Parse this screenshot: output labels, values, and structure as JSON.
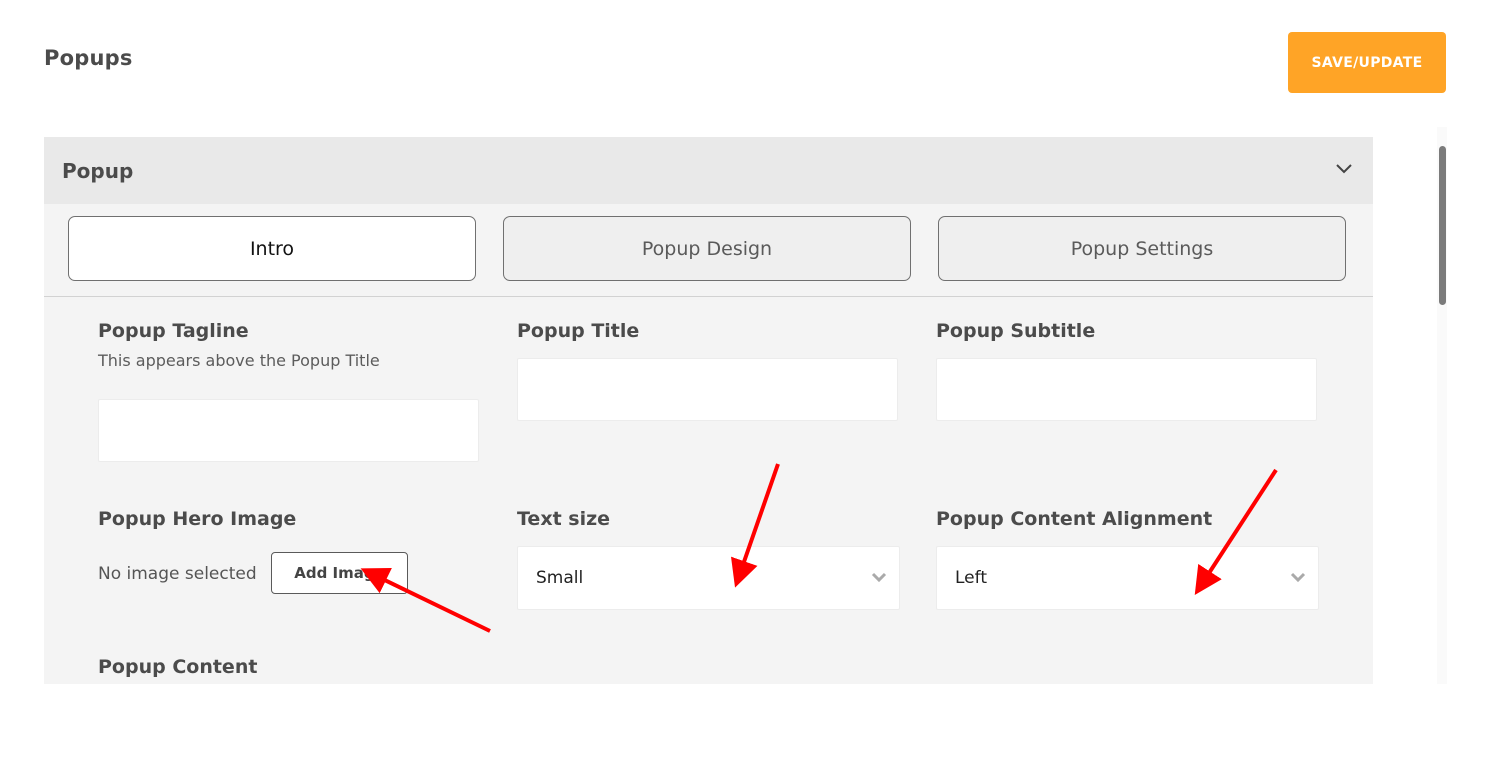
{
  "header": {
    "title": "Popups",
    "save_label": "SAVE/UPDATE"
  },
  "panel": {
    "title": "Popup",
    "tabs": [
      {
        "label": "Intro",
        "active": true
      },
      {
        "label": "Popup Design",
        "active": false
      },
      {
        "label": "Popup Settings",
        "active": false
      }
    ]
  },
  "fields": {
    "tagline": {
      "label": "Popup Tagline",
      "help": "This appears above the Popup Title",
      "value": ""
    },
    "title": {
      "label": "Popup Title",
      "value": ""
    },
    "subtitle": {
      "label": "Popup Subtitle",
      "value": ""
    },
    "hero_image": {
      "label": "Popup Hero Image",
      "status": "No image selected",
      "button_label": "Add Image"
    },
    "text_size": {
      "label": "Text size",
      "value": "Small"
    },
    "alignment": {
      "label": "Popup Content Alignment",
      "value": "Left"
    },
    "content": {
      "label": "Popup Content"
    }
  },
  "colors": {
    "accent": "#ffa426",
    "annotation_arrow": "#ff0000"
  },
  "icons": [
    "chevron-down-icon",
    "select-chevron-icon",
    "arrow-annotation"
  ]
}
